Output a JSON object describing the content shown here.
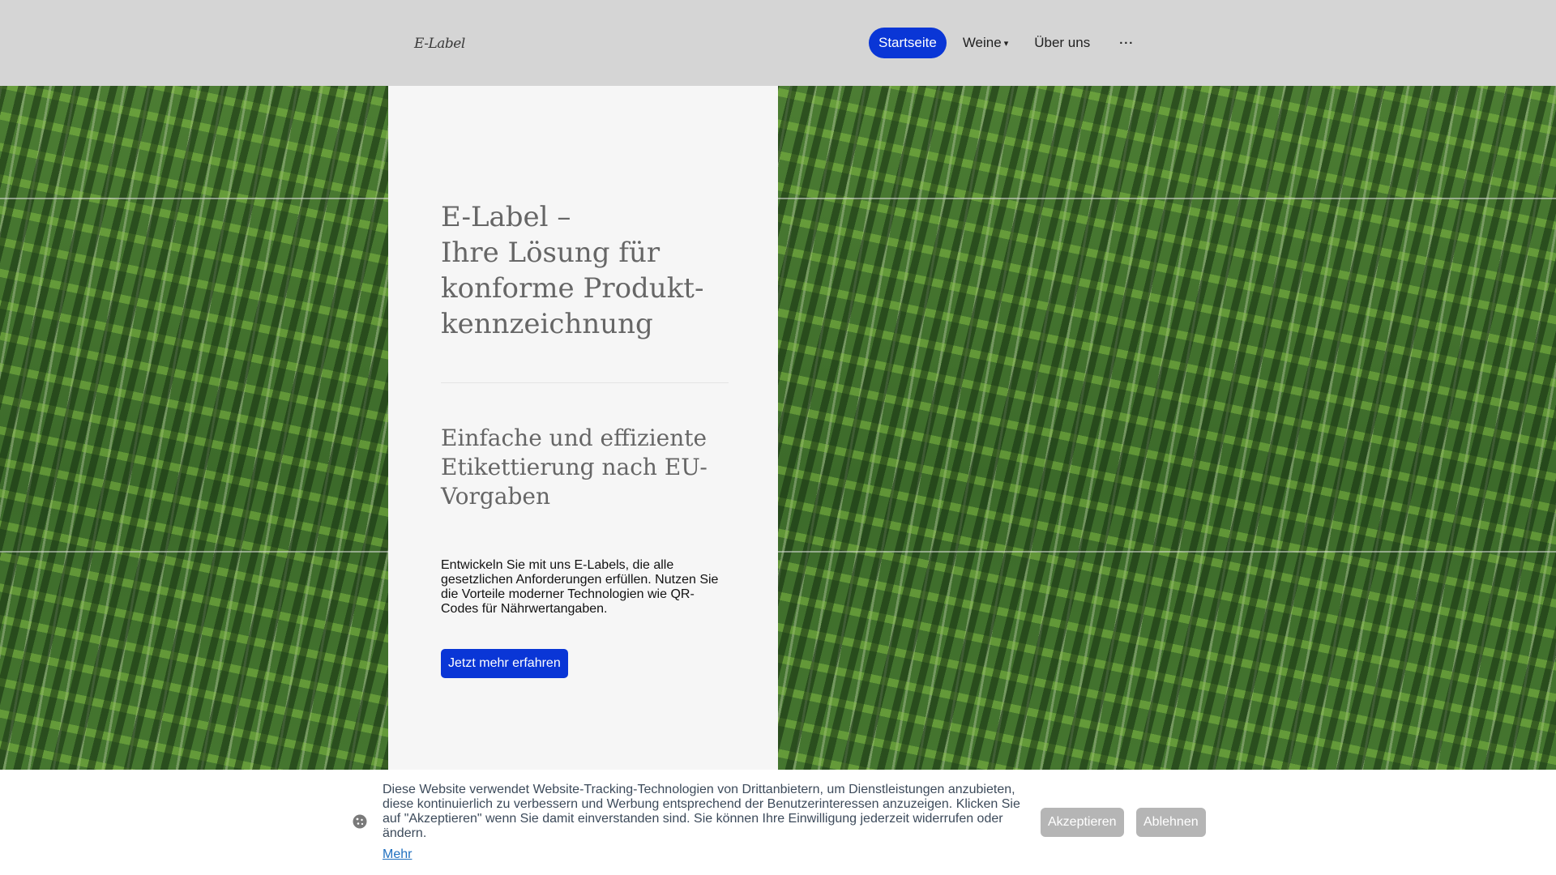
{
  "header": {
    "logo": "E-Label",
    "nav": [
      {
        "label": "Startseite",
        "active": true
      },
      {
        "label": "Weine",
        "caret": "▾"
      },
      {
        "label": "Über uns"
      },
      {
        "label": "···"
      }
    ]
  },
  "hero": {
    "title_lines": [
      "E-Label –",
      "Ihre Lösung für",
      "konforme Produkt-",
      "kennzeichnung"
    ],
    "subtitle_lines": [
      "Einfache und effiziente",
      "Etikettierung nach EU-",
      "Vorgaben"
    ],
    "body": "Entwickeln Sie mit uns E-Labels, die alle gesetzlichen Anforderungen erfüllen. Nutzen Sie die Vorteile moderner Technologien wie QR-Codes für Nährwertangaben.",
    "cta": "Jetzt mehr erfahren"
  },
  "cookie": {
    "text": "Diese Website verwendet Website-Tracking-Technologien von Drittanbietern, um Dienstleistungen anzubieten, diese kontinuierlich zu verbessern und Werbung entsprechend der Benutzerinteressen anzuzeigen. Klicken Sie auf \"Akzeptieren\" wenn Sie damit einverstanden sind. Sie können Ihre Einwilligung jederzeit widerrufen oder ändern.",
    "more": "Mehr",
    "accept": "Akzeptieren",
    "decline": "Ablehnen",
    "icon": "cookie-icon"
  },
  "colors": {
    "accent": "#0a36d6",
    "header_bg": "#d5d5d5",
    "panel_bg": "#f6f6f6",
    "cookie_button": "#b5b5b5",
    "link": "#1f6fbf"
  }
}
